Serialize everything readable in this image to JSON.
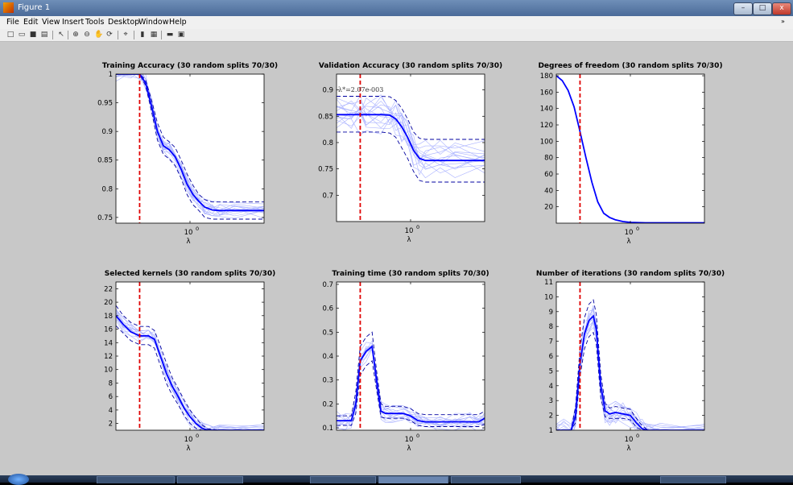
{
  "window": {
    "title": "Figure 1",
    "min_label": "–",
    "max_label": "□",
    "close_label": "x"
  },
  "menu": {
    "items": [
      "File",
      "Edit",
      "View",
      "Insert",
      "Tools",
      "Desktop",
      "Window",
      "Help"
    ],
    "arrow": "»"
  },
  "toolbar": {
    "icons": [
      "new-figure-icon",
      "open-file-icon",
      "save-icon",
      "print-icon",
      "pointer-icon",
      "zoom-in-icon",
      "zoom-out-icon",
      "pan-icon",
      "rotate-icon",
      "data-cursor-icon",
      "colorbar-icon",
      "legend-icon",
      "hide-plot-tools-icon",
      "show-plot-tools-icon"
    ]
  },
  "colors": {
    "mean": "#0000ff",
    "runs": "#aab2ff",
    "bands": "#0000a0",
    "vline": "#e00000",
    "figure_bg": "#c8c8c8"
  },
  "chart_data": [
    {
      "type": "line",
      "title": "Training Accuracy (30 random splits 70/30)",
      "xlabel": "λ",
      "xtick_label": "10",
      "xtick_exp": "0",
      "ylim": [
        0.74,
        1.0
      ],
      "yticks": [
        0.75,
        0.8,
        0.85,
        0.9,
        0.95,
        1
      ],
      "ytick_labels": [
        "0.75",
        "0.8",
        "0.85",
        "0.9",
        "0.95",
        "1"
      ],
      "selected_lambda_t": 0.16,
      "annotation": "",
      "t": [
        0,
        0.1,
        0.16,
        0.2,
        0.24,
        0.28,
        0.32,
        0.36,
        0.4,
        0.44,
        0.48,
        0.52,
        0.56,
        0.6,
        0.65,
        0.7,
        0.8,
        1.0
      ],
      "mean": [
        1.0,
        1.0,
        1.0,
        0.985,
        0.945,
        0.9,
        0.875,
        0.868,
        0.856,
        0.834,
        0.808,
        0.79,
        0.778,
        0.768,
        0.763,
        0.762,
        0.762,
        0.762
      ],
      "upper": [
        1.0,
        1.0,
        1.0,
        0.99,
        0.955,
        0.915,
        0.89,
        0.882,
        0.872,
        0.85,
        0.826,
        0.806,
        0.79,
        0.781,
        0.777,
        0.777,
        0.777,
        0.777
      ],
      "lower": [
        1.0,
        1.0,
        1.0,
        0.98,
        0.935,
        0.885,
        0.86,
        0.852,
        0.84,
        0.818,
        0.79,
        0.772,
        0.762,
        0.75,
        0.747,
        0.747,
        0.747,
        0.747
      ],
      "run_spread": 0.02
    },
    {
      "type": "line",
      "title": "Validation Accuracy (30 random splits 70/30)",
      "xlabel": "λ",
      "xtick_label": "10",
      "xtick_exp": "0",
      "ylim": [
        0.65,
        0.93
      ],
      "yticks": [
        0.7,
        0.75,
        0.8,
        0.85,
        0.9
      ],
      "ytick_labels": [
        "0.7",
        "0.75",
        "0.8",
        "0.85",
        "0.9"
      ],
      "selected_lambda_t": 0.16,
      "annotation": "λ*=2.07e-003",
      "t": [
        0,
        0.1,
        0.16,
        0.2,
        0.3,
        0.36,
        0.4,
        0.44,
        0.48,
        0.52,
        0.56,
        0.6,
        0.7,
        0.8,
        1.0
      ],
      "mean": [
        0.853,
        0.853,
        0.853,
        0.853,
        0.853,
        0.852,
        0.845,
        0.83,
        0.81,
        0.785,
        0.77,
        0.766,
        0.766,
        0.766,
        0.766
      ],
      "upper": [
        0.888,
        0.888,
        0.888,
        0.888,
        0.888,
        0.887,
        0.88,
        0.865,
        0.845,
        0.82,
        0.808,
        0.806,
        0.806,
        0.806,
        0.806
      ],
      "lower": [
        0.82,
        0.82,
        0.82,
        0.82,
        0.82,
        0.818,
        0.81,
        0.79,
        0.77,
        0.745,
        0.728,
        0.725,
        0.725,
        0.725,
        0.725
      ],
      "run_spread": 0.05
    },
    {
      "type": "line",
      "title": "Degrees of freedom (30 random splits 70/30)",
      "xlabel": "λ",
      "xtick_label": "10",
      "xtick_exp": "0",
      "ylim": [
        0,
        182
      ],
      "yticks": [
        20,
        40,
        60,
        80,
        100,
        120,
        140,
        160,
        180
      ],
      "ytick_labels": [
        "20",
        "40",
        "60",
        "80",
        "100",
        "120",
        "140",
        "160",
        "180"
      ],
      "selected_lambda_t": 0.16,
      "annotation": "",
      "t": [
        0,
        0.04,
        0.08,
        0.12,
        0.16,
        0.2,
        0.24,
        0.28,
        0.32,
        0.36,
        0.4,
        0.45,
        0.5,
        0.6,
        1.0
      ],
      "mean": [
        180,
        174,
        162,
        142,
        112,
        80,
        50,
        26,
        12,
        7,
        4,
        2,
        1,
        0.5,
        0.5
      ],
      "upper": [],
      "lower": [],
      "run_spread": 0
    },
    {
      "type": "line",
      "title": "Selected kernels  (30 random splits 70/30)",
      "xlabel": "λ",
      "xtick_label": "10",
      "xtick_exp": "0",
      "ylim": [
        1,
        23
      ],
      "yticks": [
        2,
        4,
        6,
        8,
        10,
        12,
        14,
        16,
        18,
        20,
        22
      ],
      "ytick_labels": [
        "2",
        "4",
        "6",
        "8",
        "10",
        "12",
        "14",
        "16",
        "18",
        "20",
        "22"
      ],
      "selected_lambda_t": 0.16,
      "annotation": "",
      "t": [
        0,
        0.05,
        0.1,
        0.16,
        0.22,
        0.26,
        0.3,
        0.34,
        0.38,
        0.42,
        0.46,
        0.5,
        0.54,
        0.58,
        0.62,
        0.7,
        1.0
      ],
      "mean": [
        18,
        16.7,
        15.6,
        15.0,
        15.0,
        14.5,
        12.0,
        9.5,
        7.5,
        6.0,
        4.3,
        3.0,
        2.0,
        1.3,
        1.0,
        1.0,
        1.0
      ],
      "upper": [
        19.5,
        18.0,
        17.0,
        16.4,
        16.4,
        15.8,
        13.5,
        11.0,
        8.8,
        7.2,
        5.5,
        4.0,
        2.8,
        1.8,
        1.2,
        1.0,
        1.0
      ],
      "lower": [
        16.5,
        15.4,
        14.3,
        13.7,
        13.7,
        13.2,
        10.6,
        8.0,
        6.2,
        4.8,
        3.2,
        2.0,
        1.3,
        1.0,
        1.0,
        1.0,
        1.0
      ],
      "run_spread": 1.5
    },
    {
      "type": "line",
      "title": "Training time  (30 random splits 70/30)",
      "xlabel": "λ",
      "xtick_label": "10",
      "xtick_exp": "0",
      "ylim": [
        0.09,
        0.71
      ],
      "yticks": [
        0.1,
        0.2,
        0.3,
        0.4,
        0.5,
        0.6,
        0.7
      ],
      "ytick_labels": [
        "0.1",
        "0.2",
        "0.3",
        "0.4",
        "0.5",
        "0.6",
        "0.7"
      ],
      "selected_lambda_t": 0.16,
      "annotation": "",
      "t": [
        0,
        0.06,
        0.1,
        0.13,
        0.16,
        0.2,
        0.24,
        0.27,
        0.3,
        0.33,
        0.38,
        0.45,
        0.5,
        0.55,
        0.6,
        0.7,
        0.8,
        0.9,
        0.96,
        1.0
      ],
      "mean": [
        0.13,
        0.13,
        0.13,
        0.2,
        0.38,
        0.42,
        0.44,
        0.3,
        0.17,
        0.16,
        0.16,
        0.16,
        0.15,
        0.13,
        0.125,
        0.125,
        0.125,
        0.125,
        0.125,
        0.14
      ],
      "upper": [
        0.15,
        0.15,
        0.15,
        0.25,
        0.44,
        0.48,
        0.5,
        0.34,
        0.2,
        0.19,
        0.19,
        0.19,
        0.18,
        0.16,
        0.155,
        0.155,
        0.155,
        0.155,
        0.155,
        0.17
      ],
      "lower": [
        0.11,
        0.11,
        0.11,
        0.16,
        0.32,
        0.36,
        0.38,
        0.26,
        0.145,
        0.14,
        0.14,
        0.14,
        0.13,
        0.11,
        0.105,
        0.105,
        0.105,
        0.105,
        0.105,
        0.115
      ],
      "run_spread": 0.05
    },
    {
      "type": "line",
      "title": "Number of iterations  (30 random splits 70/30)",
      "xlabel": "λ",
      "xtick_label": "10",
      "xtick_exp": "0",
      "ylim": [
        1,
        11
      ],
      "yticks": [
        1,
        2,
        3,
        4,
        5,
        6,
        7,
        8,
        9,
        10,
        11
      ],
      "ytick_labels": [
        "1",
        "2",
        "3",
        "4",
        "5",
        "6",
        "7",
        "8",
        "9",
        "10",
        "11"
      ],
      "selected_lambda_t": 0.16,
      "annotation": "",
      "t": [
        0,
        0.05,
        0.1,
        0.13,
        0.16,
        0.19,
        0.22,
        0.25,
        0.27,
        0.3,
        0.33,
        0.36,
        0.4,
        0.45,
        0.5,
        0.54,
        0.58,
        0.62,
        0.7,
        1.0
      ],
      "mean": [
        1,
        1,
        1,
        2.0,
        5.5,
        7.5,
        8.4,
        8.7,
        7.8,
        4.0,
        2.3,
        2.1,
        2.2,
        2.1,
        2.0,
        1.5,
        1.1,
        1.0,
        1.0,
        1.0
      ],
      "upper": [
        1,
        1,
        1,
        2.6,
        6.5,
        8.6,
        9.5,
        9.8,
        8.8,
        4.8,
        2.8,
        2.5,
        2.6,
        2.5,
        2.4,
        1.8,
        1.3,
        1.0,
        1.0,
        1.0
      ],
      "lower": [
        1,
        1,
        1,
        1.5,
        4.6,
        6.5,
        7.3,
        7.6,
        6.8,
        3.2,
        1.9,
        1.8,
        1.8,
        1.8,
        1.7,
        1.2,
        1.0,
        1.0,
        1.0,
        1.0
      ],
      "run_spread": 1.0
    }
  ]
}
